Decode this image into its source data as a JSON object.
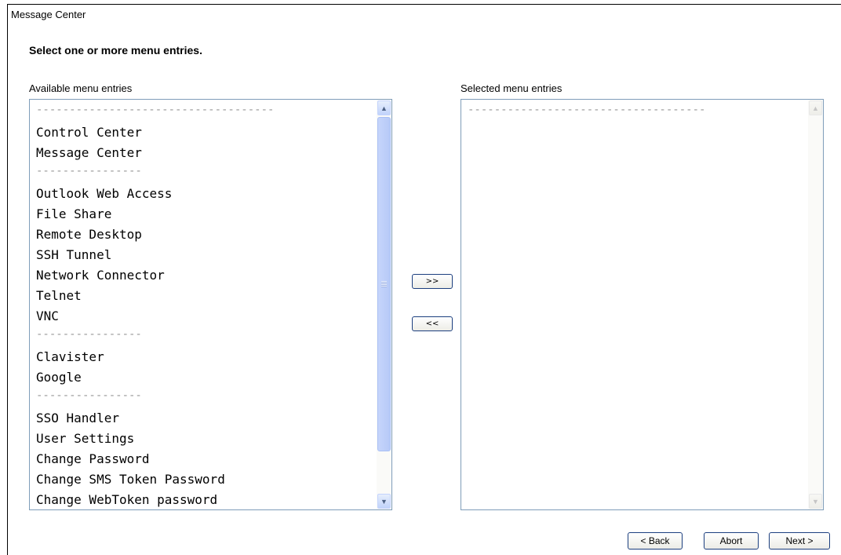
{
  "window": {
    "title": "Message Center"
  },
  "heading": "Select one or more menu entries.",
  "available": {
    "label": "Available menu entries",
    "items": [
      {
        "text": "------------------------------------",
        "sep": true
      },
      {
        "text": "Control Center"
      },
      {
        "text": "Message Center"
      },
      {
        "text": "----------------",
        "sep": true
      },
      {
        "text": "Outlook Web Access"
      },
      {
        "text": "File Share"
      },
      {
        "text": "Remote Desktop"
      },
      {
        "text": "SSH Tunnel"
      },
      {
        "text": "Network Connector"
      },
      {
        "text": "Telnet"
      },
      {
        "text": "VNC"
      },
      {
        "text": "----------------",
        "sep": true
      },
      {
        "text": "Clavister"
      },
      {
        "text": "Google"
      },
      {
        "text": "----------------",
        "sep": true
      },
      {
        "text": "SSO Handler"
      },
      {
        "text": "User Settings"
      },
      {
        "text": "Change Password"
      },
      {
        "text": "Change SMS Token Password"
      },
      {
        "text": "Change WebToken password"
      }
    ]
  },
  "selected": {
    "label": "Selected menu entries",
    "items": [
      {
        "text": "------------------------------------",
        "sep": true
      }
    ]
  },
  "buttons": {
    "add": ">>",
    "remove": "<<",
    "back": "< Back",
    "abort": "Abort",
    "next": "Next >"
  },
  "icons": {
    "scroll_up": "▲",
    "scroll_down": "▼"
  }
}
